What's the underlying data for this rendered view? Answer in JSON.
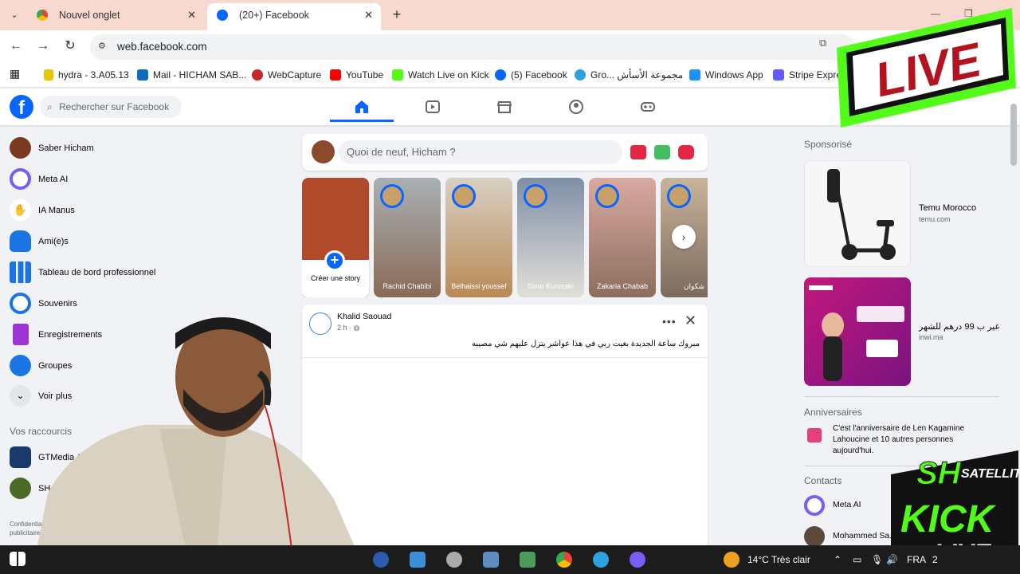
{
  "browser": {
    "tabs": [
      {
        "title": "Nouvel onglet"
      },
      {
        "title": "(20+) Facebook"
      }
    ],
    "url": "web.facebook.com",
    "bookmarks": [
      {
        "label": "hydra - 3.A05.13"
      },
      {
        "label": "Mail - HICHAM SAB..."
      },
      {
        "label": "WebCapture"
      },
      {
        "label": "YouTube"
      },
      {
        "label": "Watch Live on Kick"
      },
      {
        "label": "(5) Facebook"
      },
      {
        "label": "Gro... مجموعة الأسأش"
      },
      {
        "label": "Windows App"
      },
      {
        "label": "Stripe Express"
      }
    ]
  },
  "facebook": {
    "search_placeholder": "Rechercher sur Facebook",
    "left_menu": [
      {
        "label": "Saber Hicham",
        "icon": "avatar"
      },
      {
        "label": "Meta AI",
        "icon": "meta-ai-icon"
      },
      {
        "label": "IA Manus",
        "icon": "manus-icon"
      },
      {
        "label": "Ami(e)s",
        "icon": "friends-icon"
      },
      {
        "label": "Tableau de bord professionnel",
        "icon": "dashboard-icon"
      },
      {
        "label": "Souvenirs",
        "icon": "memories-icon"
      },
      {
        "label": "Enregistrements",
        "icon": "bookmark-icon"
      },
      {
        "label": "Groupes",
        "icon": "groups-icon"
      },
      {
        "label": "Voir plus",
        "icon": "chevron-down-icon"
      }
    ],
    "shortcuts_heading": "Vos raccourcis",
    "shortcuts": [
      {
        "label": "GTMedia Arab & Europ"
      },
      {
        "label": "SH live"
      }
    ],
    "footer": "Confidentialité · publicitaires",
    "composer_placeholder": "Quoi de neuf, Hicham ?",
    "create_story": "Créer une story",
    "stories": [
      {
        "name": "Rachid Chabibi"
      },
      {
        "name": "Belhaissi youssef"
      },
      {
        "name": "Simo Kurosaki"
      },
      {
        "name": "Zakaria Chabab"
      },
      {
        "name": "شكوان"
      }
    ],
    "post": {
      "author": "Khalid Saouad",
      "time": "2 h ·",
      "text": "مبروك ساعة الجديدة بغيت ربي في هذا عواشر يتزل عليهم شي مصيبه"
    },
    "sponsored_heading": "Sponsorisé",
    "ads": [
      {
        "title": "Temu Morocco",
        "domain": "temu.com"
      },
      {
        "title": "غير ب 99 درهم للشهر",
        "domain": "inwi.ma"
      }
    ],
    "birthdays_heading": "Anniversaires",
    "birthday_text": "C'est l'anniversaire de Len Kagamine Lahoucine et 10 autres personnes aujourd'hui.",
    "contacts_heading": "Contacts",
    "contacts": [
      {
        "name": "Meta AI"
      },
      {
        "name": "Mohammed Sa..."
      }
    ]
  },
  "taskbar": {
    "weather": "14°C  Très clair",
    "lang": "FRA",
    "time": "2"
  },
  "overlays": {
    "live_badge": "LIVE",
    "kick_brand": "SH",
    "kick_sub": "SATELLITE",
    "kick_word": "KICK",
    "kick_live": "LIVE"
  },
  "colors": {
    "facebook_blue": "#0866ff",
    "live_red": "#b3121f",
    "kick_green": "#53fc18"
  }
}
